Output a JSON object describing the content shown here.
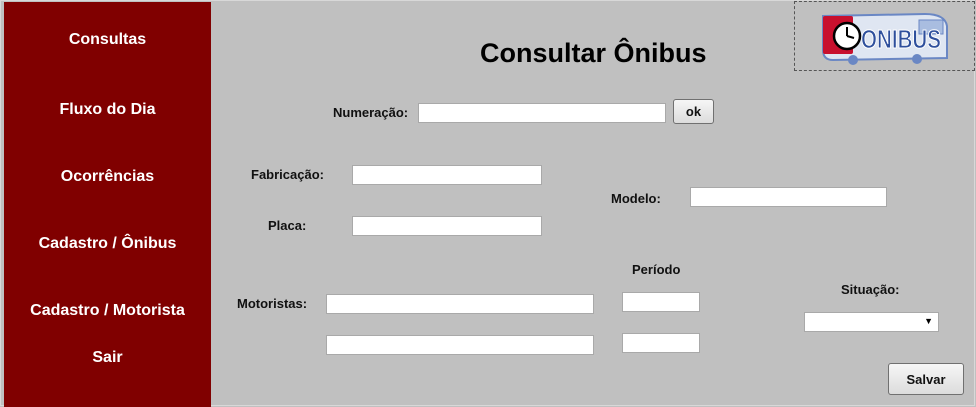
{
  "sidebar": {
    "items": [
      {
        "label": "Consultas"
      },
      {
        "label": "Fluxo do Dia"
      },
      {
        "label": "Ocorrências"
      },
      {
        "label": "Cadastro / Ônibus"
      },
      {
        "label": "Cadastro / Motorista"
      },
      {
        "label": "Sair"
      }
    ]
  },
  "page": {
    "title": "Consultar Ônibus"
  },
  "logo": {
    "text": "ONIBUS",
    "icon": "clock-icon"
  },
  "form": {
    "numeracao_label": "Numeração:",
    "numeracao_value": "",
    "ok_label": "ok",
    "fabricacao_label": "Fabricação:",
    "fabricacao_value": "",
    "placa_label": "Placa:",
    "placa_value": "",
    "modelo_label": "Modelo:",
    "modelo_value": "",
    "periodo_label": "Período",
    "motoristas_label": "Motoristas:",
    "motorista1_value": "",
    "motorista2_value": "",
    "periodo1_value": "",
    "periodo2_value": "",
    "situacao_label": "Situação:",
    "situacao_value": "",
    "salvar_label": "Salvar"
  },
  "colors": {
    "sidebar": "#800000",
    "background": "#c0c0c0",
    "logo_red": "#c8102e",
    "logo_blue": "#4a6fb5"
  }
}
